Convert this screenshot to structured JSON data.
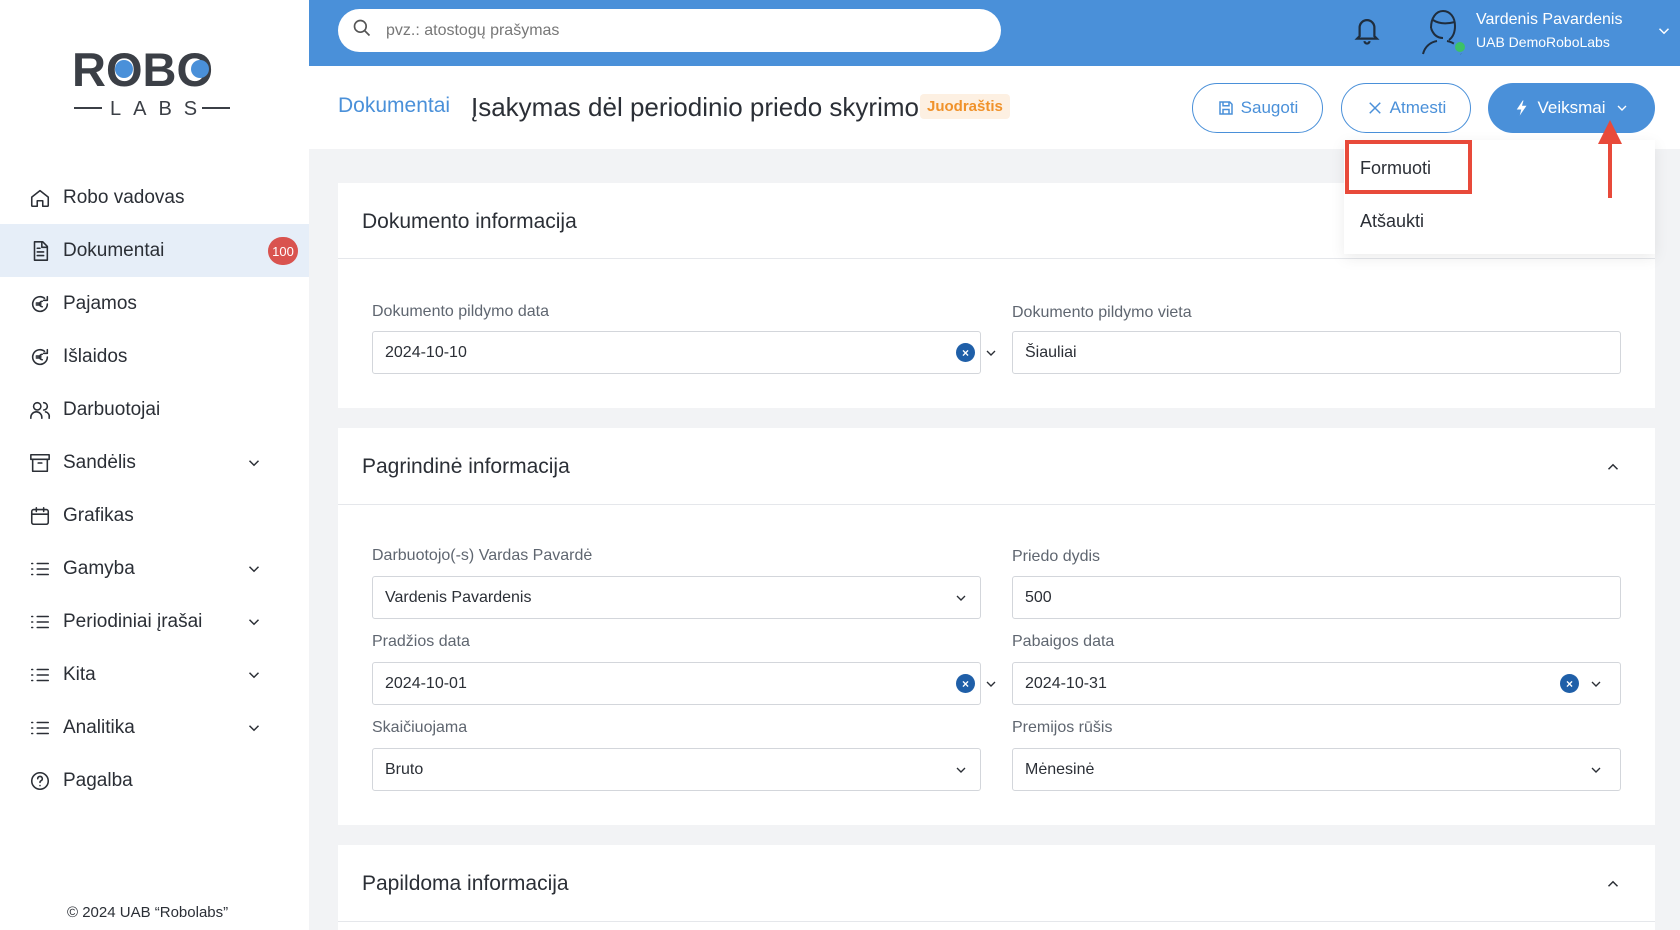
{
  "logo": {
    "text_top": "ROBO",
    "text_bottom": "LABS"
  },
  "sidebar": {
    "items": [
      {
        "label": "Robo vadovas",
        "icon": "home-icon"
      },
      {
        "label": "Dokumentai",
        "icon": "document-icon",
        "badge": "100",
        "active": true
      },
      {
        "label": "Pajamos",
        "icon": "euro-icon"
      },
      {
        "label": "Išlaidos",
        "icon": "euro-icon"
      },
      {
        "label": "Darbuotojai",
        "icon": "users-icon"
      },
      {
        "label": "Sandėlis",
        "icon": "archive-icon",
        "expandable": true
      },
      {
        "label": "Grafikas",
        "icon": "calendar-icon"
      },
      {
        "label": "Gamyba",
        "icon": "list-icon",
        "expandable": true
      },
      {
        "label": "Periodiniai įrašai",
        "icon": "list-icon",
        "expandable": true
      },
      {
        "label": "Kita",
        "icon": "list-icon",
        "expandable": true
      },
      {
        "label": "Analitika",
        "icon": "list-icon",
        "expandable": true
      },
      {
        "label": "Pagalba",
        "icon": "help-icon"
      }
    ],
    "copyright": "© 2024 UAB “Robolabs”"
  },
  "topbar": {
    "search_placeholder": "pvz.: atostogų prašymas",
    "user_name": "Vardenis Pavardenis",
    "user_company": "UAB DemoRoboLabs"
  },
  "header": {
    "breadcrumb": "Dokumentai",
    "title": "Įsakymas dėl periodinio priedo skyrimo",
    "status": "Juodraštis",
    "save_label": "Saugoti",
    "reject_label": "Atmesti",
    "actions_label": "Veiksmai"
  },
  "actions_menu": {
    "items": [
      "Formuoti",
      "Atšaukti"
    ]
  },
  "sections": {
    "doc_info": {
      "title": "Dokumento informacija",
      "date_label": "Dokumento pildymo data",
      "date_value": "2024-10-10",
      "place_label": "Dokumento pildymo vieta",
      "place_value": "Šiauliai"
    },
    "main_info": {
      "title": "Pagrindinė informacija",
      "employee_label": "Darbuotojo(-s) Vardas Pavardė",
      "employee_value": "Vardenis Pavardenis",
      "amount_label": "Priedo dydis",
      "amount_value": "500",
      "start_label": "Pradžios data",
      "start_value": "2024-10-01",
      "end_label": "Pabaigos data",
      "end_value": "2024-10-31",
      "calc_label": "Skaičiuojama",
      "calc_value": "Bruto",
      "bonus_type_label": "Premijos rūšis",
      "bonus_type_value": "Mėnesinė"
    },
    "extra_info": {
      "title": "Papildoma informacija"
    }
  },
  "colors": {
    "primary": "#4a90d9",
    "badge_red": "#d9534f",
    "status_orange": "#f0922b",
    "highlight_red": "#e84a3a",
    "online_green": "#3cc167"
  }
}
